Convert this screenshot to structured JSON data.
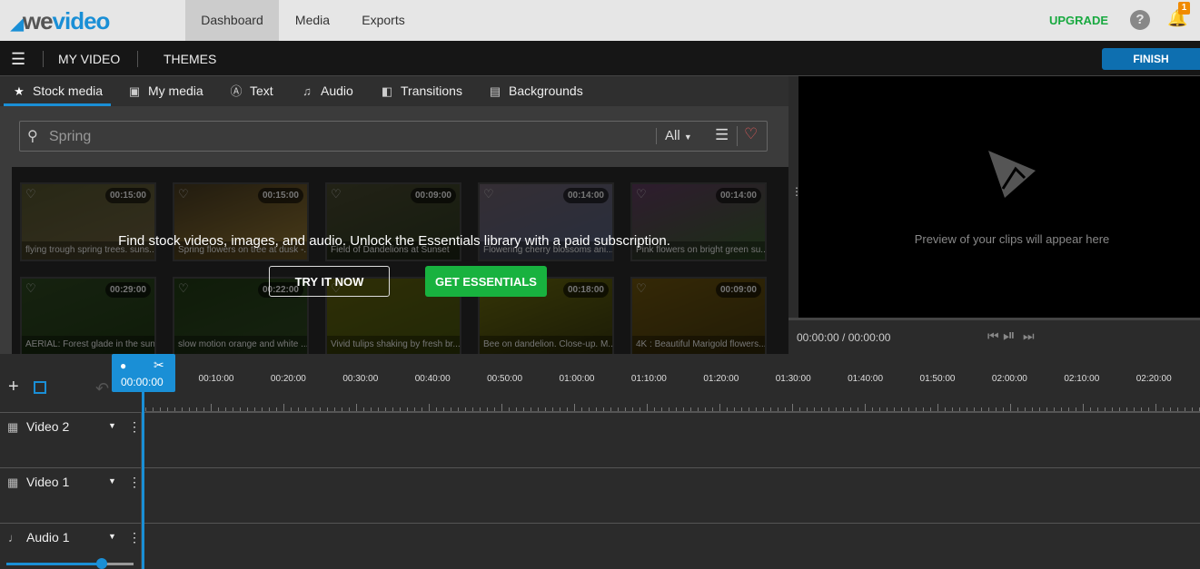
{
  "top": {
    "logo": {
      "we": "we",
      "video": "video"
    },
    "nav": [
      "Dashboard",
      "Media",
      "Exports"
    ],
    "active_nav": "Dashboard",
    "upgrade": "UPGRADE",
    "help": "?",
    "notifications": "1"
  },
  "bar2": {
    "my_video": "MY VIDEO",
    "themes": "THEMES",
    "finish": "FINISH"
  },
  "tabs": [
    {
      "label": "Stock media",
      "icon": "star-icon"
    },
    {
      "label": "My media",
      "icon": "folder-icon"
    },
    {
      "label": "Text",
      "icon": "text-icon"
    },
    {
      "label": "Audio",
      "icon": "music-icon"
    },
    {
      "label": "Transitions",
      "icon": "transition-icon"
    },
    {
      "label": "Backgrounds",
      "icon": "image-icon"
    }
  ],
  "search": {
    "placeholder": "Spring",
    "filter": "All"
  },
  "media": [
    {
      "title": "flying trough spring trees. suns...",
      "duration": "00:15:00",
      "colors": [
        "#6a6a3a",
        "#8a7a50"
      ]
    },
    {
      "title": "Spring flowers on tree at dusk -...",
      "duration": "00:15:00",
      "colors": [
        "#5a4a2a",
        "#c09a40"
      ]
    },
    {
      "title": "Field of Dandelions at Sunset",
      "duration": "00:09:00",
      "colors": [
        "#5a5a3a",
        "#3a4a2a"
      ]
    },
    {
      "title": "Flowering cherry blossoms ani...",
      "duration": "00:14:00",
      "colors": [
        "#8a7a8a",
        "#6a7aa0"
      ]
    },
    {
      "title": "Pink flowers on bright green su...",
      "duration": "00:14:00",
      "colors": [
        "#7a4a7a",
        "#4a7a3a"
      ]
    },
    {
      "title": "AERIAL: Forest glade in the sun",
      "duration": "00:29:00",
      "colors": [
        "#3a5a2a",
        "#2a4a1a"
      ]
    },
    {
      "title": "slow motion orange and white ...",
      "duration": "00:22:00",
      "colors": [
        "#2a4a1a",
        "#3a5a2a"
      ]
    },
    {
      "title": "Vivid tulips shaking by fresh br...",
      "duration": "",
      "colors": [
        "#7a7a10",
        "#5a6a10"
      ]
    },
    {
      "title": "Bee on dandelion. Close-up. M...",
      "duration": "00:18:00",
      "colors": [
        "#8a8a10",
        "#4a4a10"
      ]
    },
    {
      "title": "4K : Beautiful Marigold flowers...",
      "duration": "00:09:00",
      "colors": [
        "#8a6a10",
        "#5a4a10"
      ]
    }
  ],
  "overlay": {
    "text": "Find stock videos, images, and audio. Unlock the Essentials library with a paid subscription.",
    "try": "TRY IT NOW",
    "essentials": "GET ESSENTIALS"
  },
  "preview": {
    "text": "Preview of your clips will appear here",
    "timecode": "00:00:00 / 00:00:00"
  },
  "timeline": {
    "playhead": "00:00:00",
    "ruler": [
      "00:10:00",
      "00:20:00",
      "00:30:00",
      "00:40:00",
      "00:50:00",
      "01:00:00",
      "01:10:00",
      "01:20:00",
      "01:30:00",
      "01:40:00",
      "01:50:00",
      "02:00:00",
      "02:10:00",
      "02:20:00"
    ],
    "tracks": [
      {
        "name": "Video 2",
        "icon": "film-icon"
      },
      {
        "name": "Video 1",
        "icon": "film-icon"
      },
      {
        "name": "Audio 1",
        "icon": "music-note-icon"
      }
    ],
    "audio_volume": 0.75
  },
  "colors": {
    "accent": "#1a8fd6",
    "green": "#18b23f",
    "upgrade": "#18a940"
  }
}
